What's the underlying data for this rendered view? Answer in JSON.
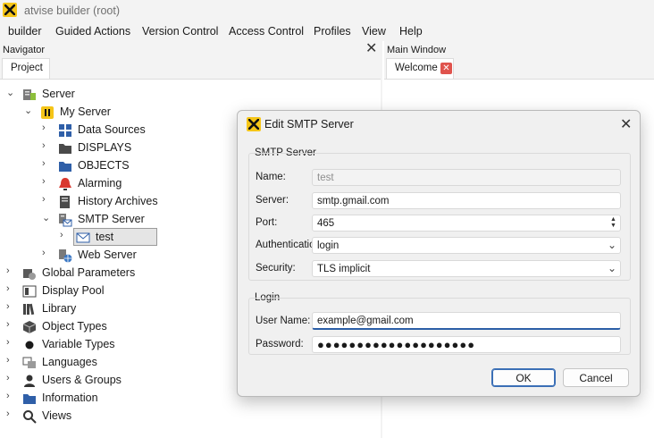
{
  "window": {
    "title": "atvise builder  (root)"
  },
  "menu": [
    "builder",
    "Guided Actions",
    "Version Control",
    "Access Control",
    "Profiles",
    "View",
    "Help"
  ],
  "navigator": {
    "title": "Navigator",
    "tab": "Project",
    "tree": [
      {
        "label": "Server",
        "icon": "server-icon",
        "expand": "open"
      },
      {
        "label": "My Server",
        "icon": "atvise-server-icon",
        "expand": "open"
      },
      {
        "label": "Data Sources",
        "icon": "grid-icon",
        "expand": "closed"
      },
      {
        "label": "DISPLAYS",
        "icon": "folder-icon",
        "expand": "closed"
      },
      {
        "label": "OBJECTS",
        "icon": "folder-icon",
        "expand": "closed"
      },
      {
        "label": "Alarming",
        "icon": "alarm-bell-icon",
        "expand": "closed"
      },
      {
        "label": "History Archives",
        "icon": "history-archive-icon",
        "expand": "closed"
      },
      {
        "label": "SMTP Server",
        "icon": "smtp-server-icon",
        "expand": "open"
      },
      {
        "label": "test",
        "icon": "envelope-icon",
        "expand": "closed"
      },
      {
        "label": "Web Server",
        "icon": "web-server-icon",
        "expand": "closed"
      },
      {
        "label": "Global Parameters",
        "icon": "global-parameters-icon",
        "expand": "closed"
      },
      {
        "label": "Display Pool",
        "icon": "display-pool-icon",
        "expand": "closed"
      },
      {
        "label": "Library",
        "icon": "library-icon",
        "expand": "closed"
      },
      {
        "label": "Object Types",
        "icon": "cube-icon",
        "expand": "closed"
      },
      {
        "label": "Variable Types",
        "icon": "dot-icon",
        "expand": "closed"
      },
      {
        "label": "Languages",
        "icon": "languages-icon",
        "expand": "closed"
      },
      {
        "label": "Users & Groups",
        "icon": "user-icon",
        "expand": "closed"
      },
      {
        "label": "Information",
        "icon": "folder-icon",
        "expand": "closed"
      },
      {
        "label": "Views",
        "icon": "magnifier-icon",
        "expand": "closed"
      }
    ]
  },
  "main": {
    "title": "Main Window",
    "tab": "Welcome"
  },
  "dialog": {
    "title": "Edit SMTP Server",
    "smtp_group": "SMTP Server",
    "labels": {
      "name": "Name:",
      "server": "Server:",
      "port": "Port:",
      "authentication": "Authentication:",
      "security": "Security:",
      "username": "User Name:",
      "password": "Password:"
    },
    "values": {
      "name": "test",
      "server": "smtp.gmail.com",
      "port": "465",
      "authentication": "login",
      "security": "TLS implicit",
      "username": "example@gmail.com",
      "password": "●●●●●●●●●●●●●●●●●●●●"
    },
    "login_group": "Login",
    "ok": "OK",
    "cancel": "Cancel"
  },
  "colors": {
    "accent": "#2b5ea7",
    "logo": "#f5c518",
    "tab_close": "#e0534d"
  }
}
